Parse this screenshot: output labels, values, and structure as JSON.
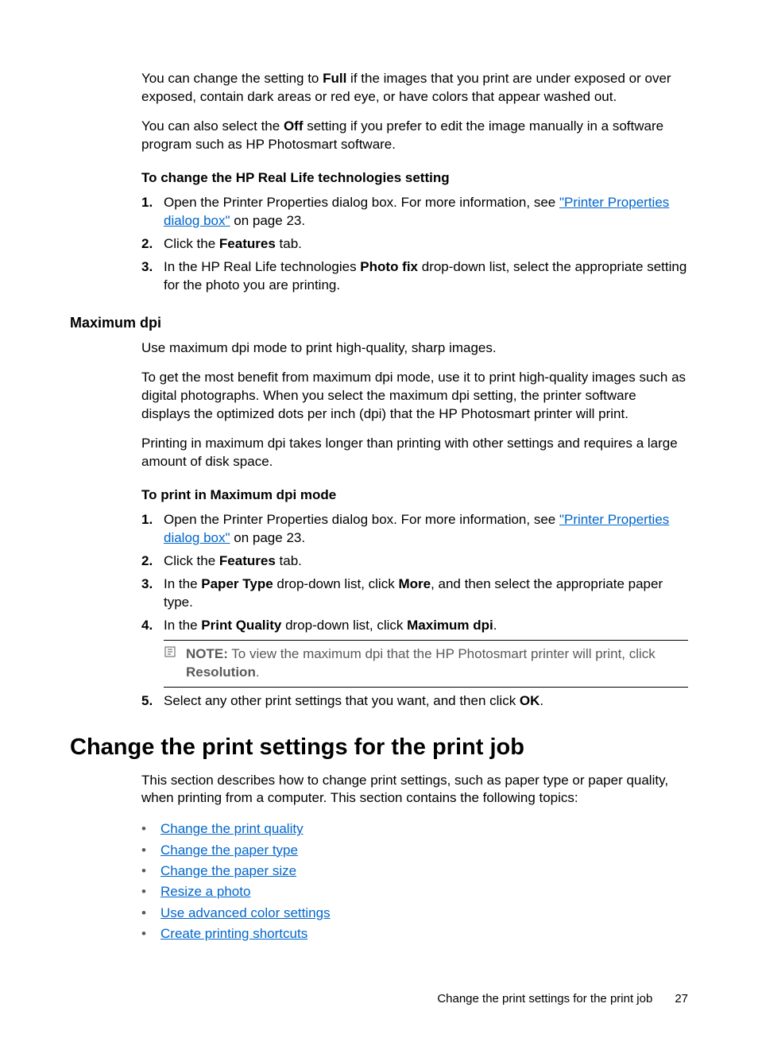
{
  "para1_a": "You can change the setting to ",
  "para1_bold": "Full",
  "para1_b": " if the images that you print are under exposed or over exposed, contain dark areas or red eye, or have colors that appear washed out.",
  "para2_a": "You can also select the ",
  "para2_bold": "Off",
  "para2_b": " setting if you prefer to edit the image manually in a software program such as HP Photosmart software.",
  "sub1": "To change the HP Real Life technologies setting",
  "steps1": {
    "s1_a": "Open the Printer Properties dialog box. For more information, see ",
    "s1_link": "\"Printer Properties dialog box\"",
    "s1_b": " on page 23.",
    "s2_a": "Click the ",
    "s2_bold": "Features",
    "s2_b": " tab.",
    "s3_a": "In the HP Real Life technologies ",
    "s3_bold": "Photo fix",
    "s3_b": " drop-down list, select the appropriate setting for the photo you are printing."
  },
  "h3": "Maximum dpi",
  "para3": "Use maximum dpi mode to print high-quality, sharp images.",
  "para4": "To get the most benefit from maximum dpi mode, use it to print high-quality images such as digital photographs. When you select the maximum dpi setting, the printer software displays the optimized dots per inch (dpi) that the HP Photosmart printer will print.",
  "para5": "Printing in maximum dpi takes longer than printing with other settings and requires a large amount of disk space.",
  "sub2": "To print in Maximum dpi mode",
  "steps2": {
    "s1_a": "Open the Printer Properties dialog box. For more information, see ",
    "s1_link": "\"Printer Properties dialog box\"",
    "s1_b": " on page 23.",
    "s2_a": "Click the ",
    "s2_bold": "Features",
    "s2_b": " tab.",
    "s3_a": "In the ",
    "s3_bold1": "Paper Type",
    "s3_b": " drop-down list, click ",
    "s3_bold2": "More",
    "s3_c": ", and then select the appropriate paper type.",
    "s4_a": "In the ",
    "s4_bold1": "Print Quality",
    "s4_b": " drop-down list, click ",
    "s4_bold2": "Maximum dpi",
    "s4_c": ".",
    "note_label": "NOTE:",
    "note_a": "  To view the maximum dpi that the HP Photosmart printer will print, click ",
    "note_bold": "Resolution",
    "note_b": ".",
    "s5_a": "Select any other print settings that you want, and then click ",
    "s5_bold": "OK",
    "s5_b": "."
  },
  "h1": "Change the print settings for the print job",
  "para6": "This section describes how to change print settings, such as paper type or paper quality, when printing from a computer. This section contains the following topics:",
  "bullets": [
    "Change the print quality",
    "Change the paper type",
    "Change the paper size",
    "Resize a photo",
    "Use advanced color settings",
    "Create printing shortcuts"
  ],
  "footer_text": "Change the print settings for the print job",
  "footer_page": "27",
  "nums": {
    "n1": "1.",
    "n2": "2.",
    "n3": "3.",
    "n4": "4.",
    "n5": "5."
  },
  "bullet_dot": "•"
}
